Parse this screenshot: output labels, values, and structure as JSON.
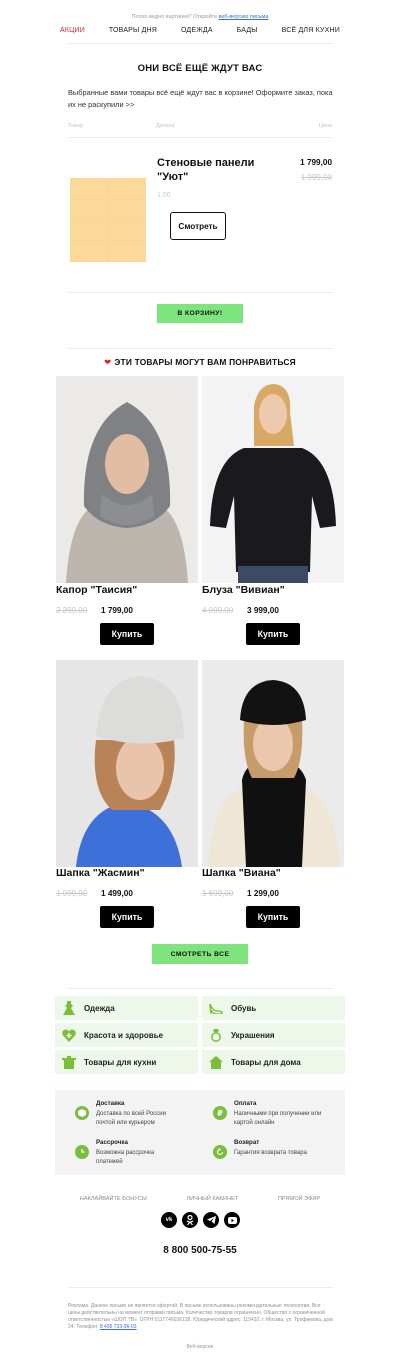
{
  "preheader": {
    "text": "Плохо видно картинки? Откройте",
    "link": "веб-версию письма"
  },
  "nav": [
    "АКЦИИ",
    "ТОВАРЫ ДНЯ",
    "ОДЕЖДА",
    "БАДЫ",
    "ВСЁ ДЛЯ КУХНИ"
  ],
  "colors": {
    "accent_red": "#e0252b",
    "accent_green": "#7ee47e",
    "cat_bg": "#eef8ea",
    "product_swatch": "#fcd899"
  },
  "cart": {
    "title": "ОНИ ВСЁ ЕЩЁ ЖДУТ ВАС",
    "intro": "Выбранные вами товары всё ещё ждут вас в корзине! Оформите заказ, пока их не раскупили >>",
    "headers": {
      "product": "Товар",
      "details": "Детали",
      "price": "Цена"
    },
    "item": {
      "name": "Стеновые панели \"Уют\"",
      "qty": "1.00",
      "price": "1 799,00",
      "old_price": "1 999,00",
      "view_label": "Смотреть"
    },
    "cart_button": "В КОРЗИНУ!"
  },
  "recommend": {
    "title": "ЭТИ ТОВАРЫ МОГУТ ВАМ ПОНРАВИТЬСЯ",
    "buy_label": "Купить",
    "items": [
      {
        "name": "Капор \"Таисия\"",
        "old_price": "2 299,00",
        "price": "1 799,00"
      },
      {
        "name": "Блуза \"Вивиан\"",
        "old_price": "4 999,00",
        "price": "3 999,00"
      },
      {
        "name": "Шапка \"Жасмин\"",
        "old_price": "1 999,00",
        "price": "1 499,00"
      },
      {
        "name": "Шапка \"Виана\"",
        "old_price": "1 699,00",
        "price": "1 299,00"
      }
    ],
    "see_all": "СМОТРЕТЬ ВСЕ"
  },
  "categories": [
    {
      "label": "Одежда",
      "icon": "dress-icon"
    },
    {
      "label": "Обувь",
      "icon": "shoe-icon"
    },
    {
      "label": "Красота и здоровье",
      "icon": "heart-plus-icon"
    },
    {
      "label": "Украшения",
      "icon": "ring-icon"
    },
    {
      "label": "Товары для кухни",
      "icon": "pot-icon"
    },
    {
      "label": "Товары для дома",
      "icon": "house-icon"
    }
  ],
  "info": [
    {
      "title": "Доставка",
      "text": "Доставка по всей России почтой или курьером",
      "icon": "box-icon"
    },
    {
      "title": "Оплата",
      "text": "Наличными при получении или картой онлайн",
      "icon": "ruble-icon"
    },
    {
      "title": "Рассрочка",
      "text": "Возможна рассрочка платежей",
      "icon": "clock-icon"
    },
    {
      "title": "Возврат",
      "text": "Гарантия возврата товара",
      "icon": "return-icon"
    }
  ],
  "footer": {
    "links": [
      "НАКЛАЙВАЙТЕ БОНУСЫ",
      "ЛИЧНЫЙ КАБИНЕТ",
      "ПРЯМОЙ ЭФИР"
    ],
    "social": [
      "vk-icon",
      "ok-icon",
      "telegram-icon",
      "youtube-icon"
    ],
    "phone": "8 800 500-75-55",
    "legal": "Реклама. Данное письмо не является офертой. В письме использованы рекомендательные технологии. Все цены действительны на момент отправки письма. Количество товаров ограничено. Общество с ограниченной ответственностью «ШОП ТВ». ОГРН 5117746036128. Юридический адрес: 115432, г. Москва, ул. Трофимова, дом 24. Телефон:",
    "legal_phone": "8 495 733-96-03",
    "web_version": "Веб-версия"
  }
}
